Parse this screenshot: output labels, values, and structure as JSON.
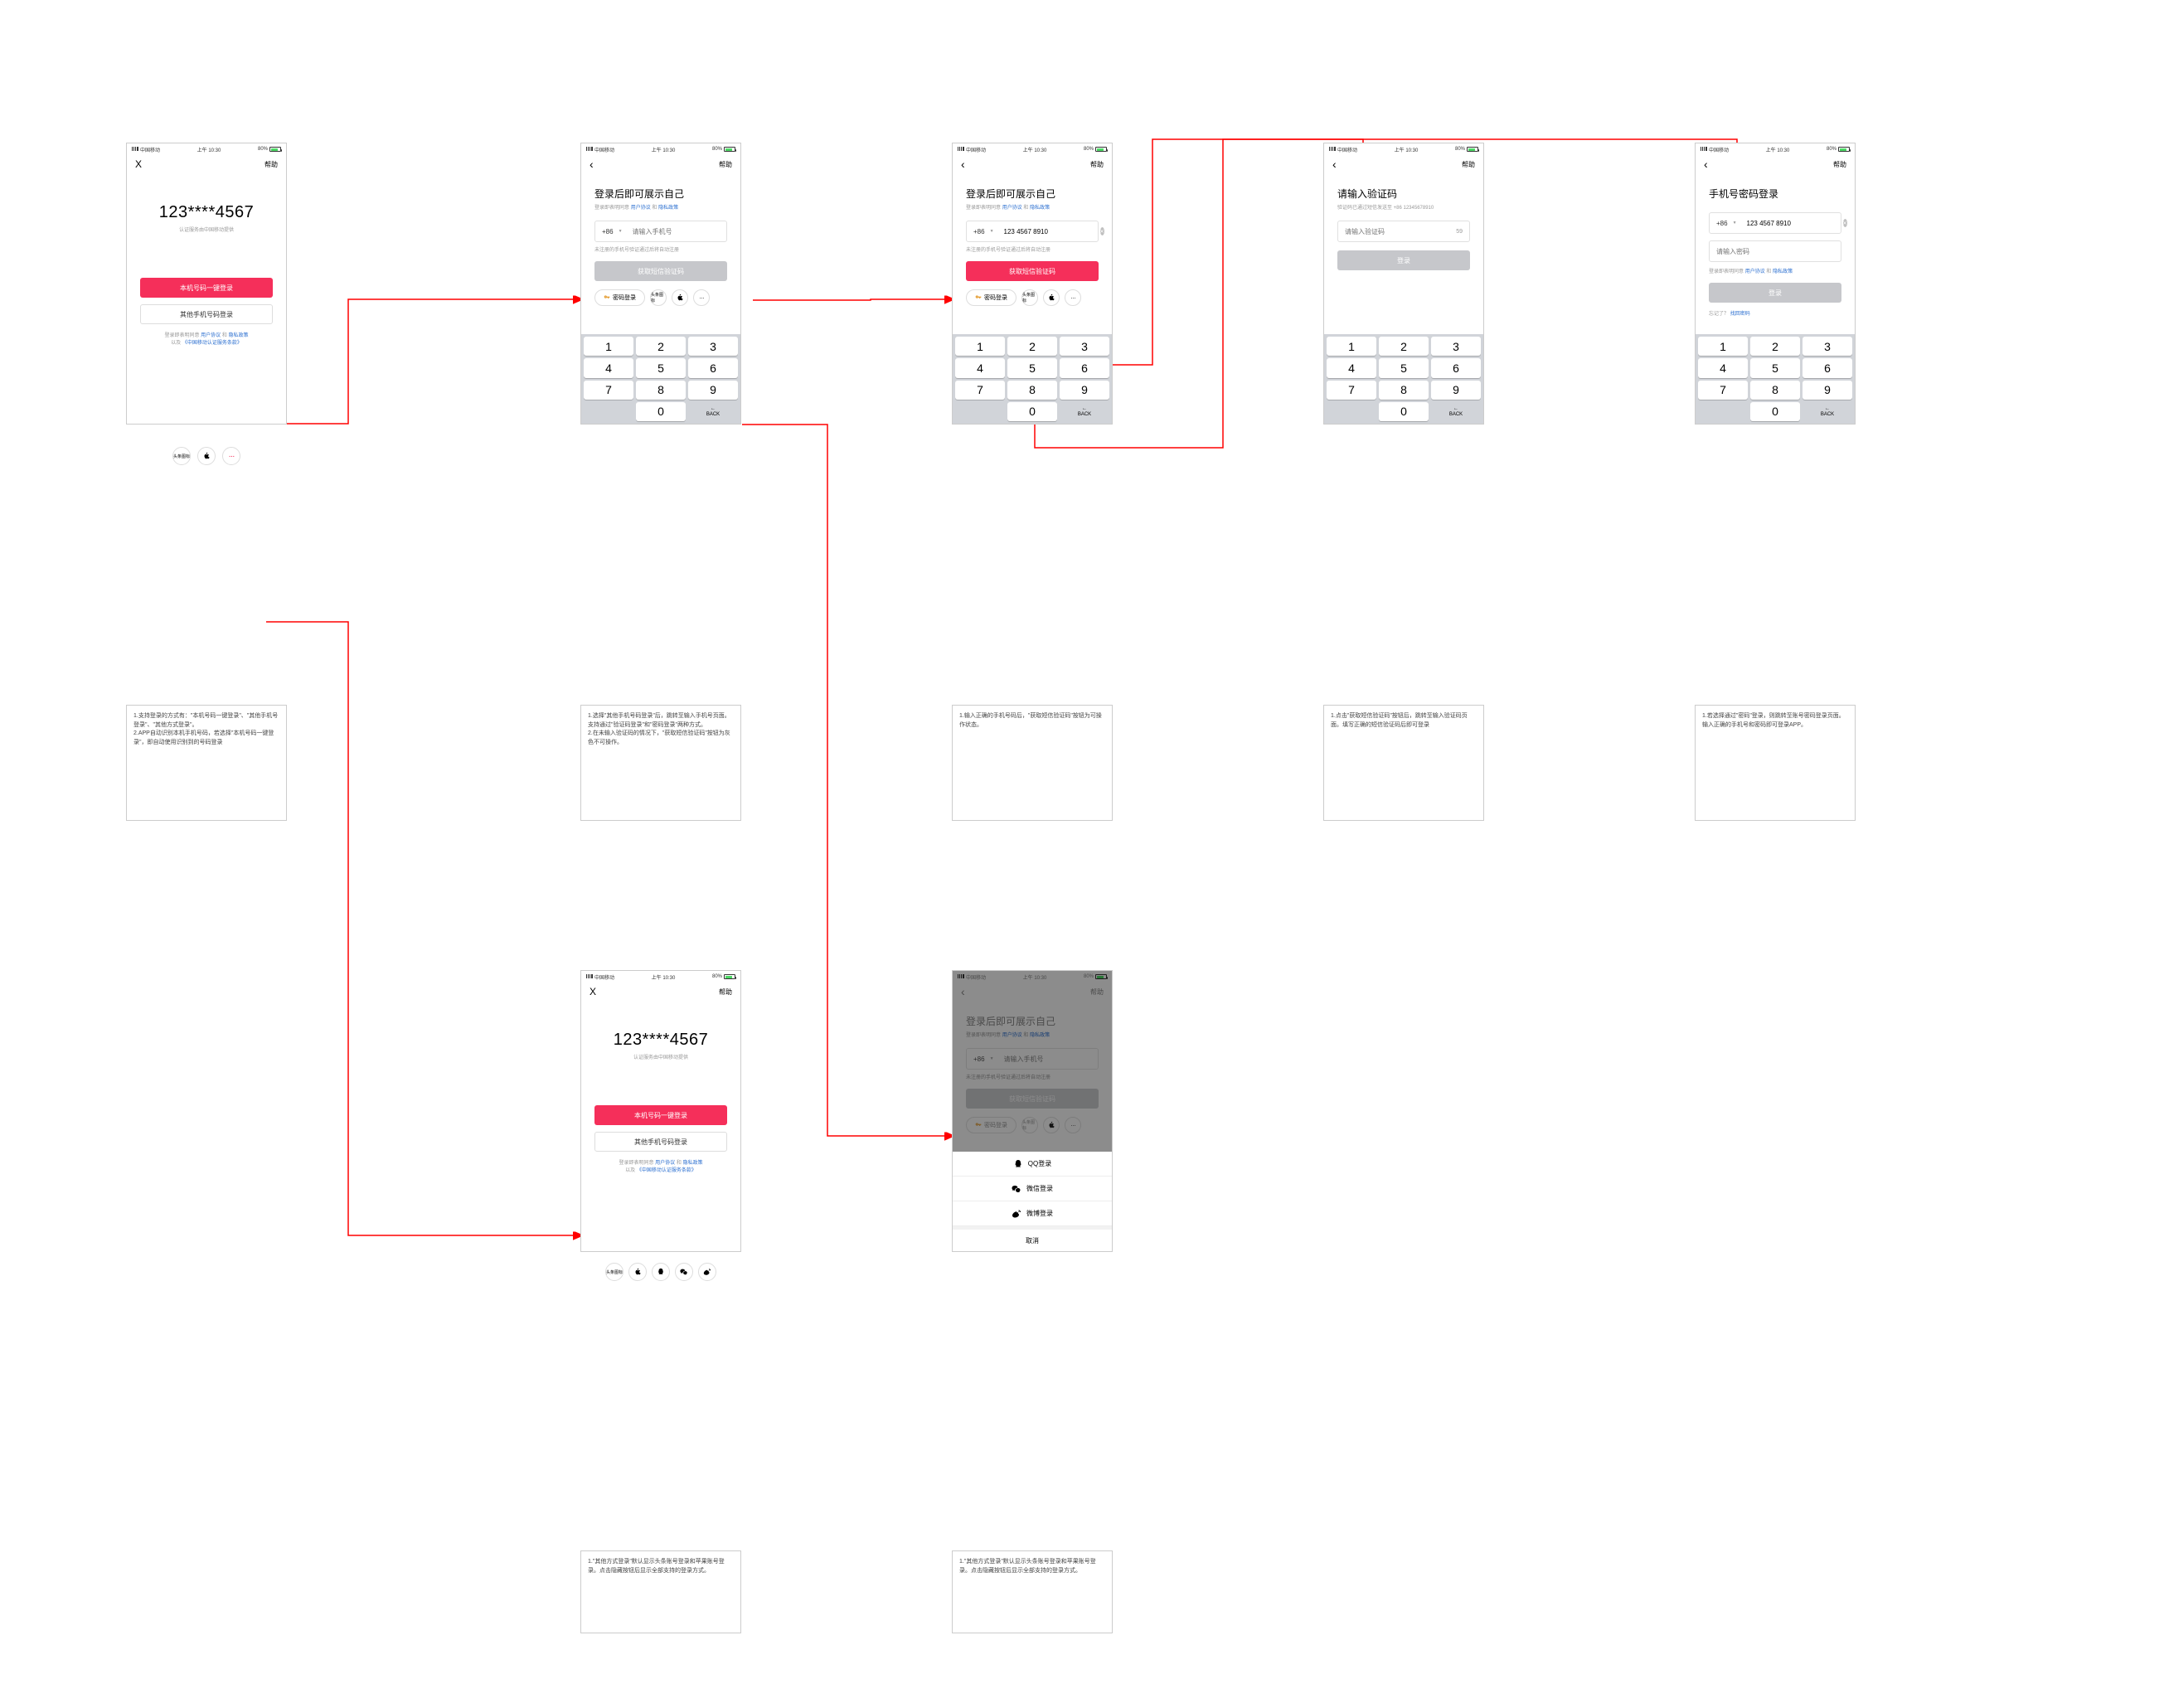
{
  "status": {
    "carrier": "中国移动",
    "time": "上午 10:30",
    "battery_pct": "80%"
  },
  "nav": {
    "close": "X",
    "back": "‹",
    "help": "帮助"
  },
  "s1": {
    "masked": "123****4567",
    "source": "认证服务由中国移动提供",
    "btn1": "本机号码一键登录",
    "btn2": "其他手机号码登录",
    "agree_prefix": "登录即表明同意",
    "ua": "用户协议",
    "and": "和",
    "pp": "隐私政策",
    "terms_prefix": "以及",
    "terms": "《中国移动认证服务条款》",
    "social": {
      "toutiao": "头条图标",
      "ellipsis": "···"
    }
  },
  "s2": {
    "title": "登录后即可展示自己",
    "agree_prefix": "登录即表明同意",
    "ua": "用户协议",
    "and": "和",
    "pp": "隐私政策",
    "cc": "+86",
    "placeholder": "请输入手机号",
    "hint": "未注册的手机号验证通过后将自动注册",
    "btn": "获取短信验证码",
    "pwd": "密码登录",
    "toutiao": "头条图标"
  },
  "s3": {
    "title": "登录后即可展示自己",
    "agree_prefix": "登录即表明同意",
    "ua": "用户协议",
    "and": "和",
    "pp": "隐私政策",
    "cc": "+86",
    "value": "123 4567 8910",
    "hint": "未注册的手机号验证通过后将自动注册",
    "btn": "获取短信验证码",
    "pwd": "密码登录",
    "toutiao": "头条图标"
  },
  "s4": {
    "title": "请输入验证码",
    "sent": "验证码已通过短信发送至 +86 12345678910",
    "placeholder": "请输入验证码",
    "countdown": "59",
    "btn": "登录"
  },
  "s5": {
    "title": "手机号密码登录",
    "cc": "+86",
    "value": "123 4567 8910",
    "pwd_placeholder": "请输入密码",
    "agree_prefix": "登录即表明同意",
    "ua": "用户协议",
    "and": "和",
    "pp": "隐私政策",
    "btn": "登录",
    "forgot_prefix": "忘记了？",
    "forgot": "找回密码"
  },
  "s6": {
    "masked": "123****4567",
    "source": "认证服务由中国移动提供",
    "btn1": "本机号码一键登录",
    "btn2": "其他手机号码登录",
    "agree_prefix": "登录即表明同意",
    "ua": "用户协议",
    "and": "和",
    "pp": "隐私政策",
    "terms_prefix": "以及",
    "terms": "《中国移动认证服务条款》",
    "toutiao": "头条图标"
  },
  "s7": {
    "title": "登录后即可展示自己",
    "agree_prefix": "登录即表明同意",
    "ua": "用户协议",
    "and": "和",
    "pp": "隐私政策",
    "cc": "+86",
    "placeholder": "请输入手机号",
    "hint": "未注册的手机号验证通过后将自动注册",
    "btn": "获取短信验证码",
    "pwd": "密码登录",
    "toutiao": "头条图标",
    "sheet": {
      "qq": "QQ登录",
      "wechat": "微信登录",
      "weibo": "微博登录",
      "cancel": "取消"
    }
  },
  "keypad": {
    "back": "BACK",
    "back_arrow": "←"
  },
  "notes": {
    "n1": "1.支持登录的方式有：\"本机号码一键登录\"、\"其他手机号登录\"、\"其他方式登录\"。\n2.APP自动识别本机手机号码，若选择\"本机号码一键登录\"，即自动使用识别到的号码登录",
    "n2": "1.选择\"其他手机号码登录\"后，跳转至输入手机号页面。支持通过\"验证码登录\"和\"密码登录\"两种方式。\n2.在未输入验证码的情况下，\"获取短信验证码\"按钮为灰色不可操作。",
    "n3": "1.输入正确的手机号码后，\"获取短信验证码\"按钮为可操作状态。",
    "n4": "1.点击\"获取短信验证码\"按钮后，跳转至输入验证码页面。填写正确的短信验证码后即可登录",
    "n5": "1.若选择通过\"密码\"登录，则跳转至账号密码登录页面。输入正确的手机号和密码即可登录APP。",
    "n6": "1.\"其他方式登录\"默认显示头条账号登录和苹果账号登录。点击隐藏按钮后显示全部支持的登录方式。",
    "n7": "1.\"其他方式登录\"默认显示头条账号登录和苹果账号登录。点击隐藏按钮后显示全部支持的登录方式。"
  }
}
